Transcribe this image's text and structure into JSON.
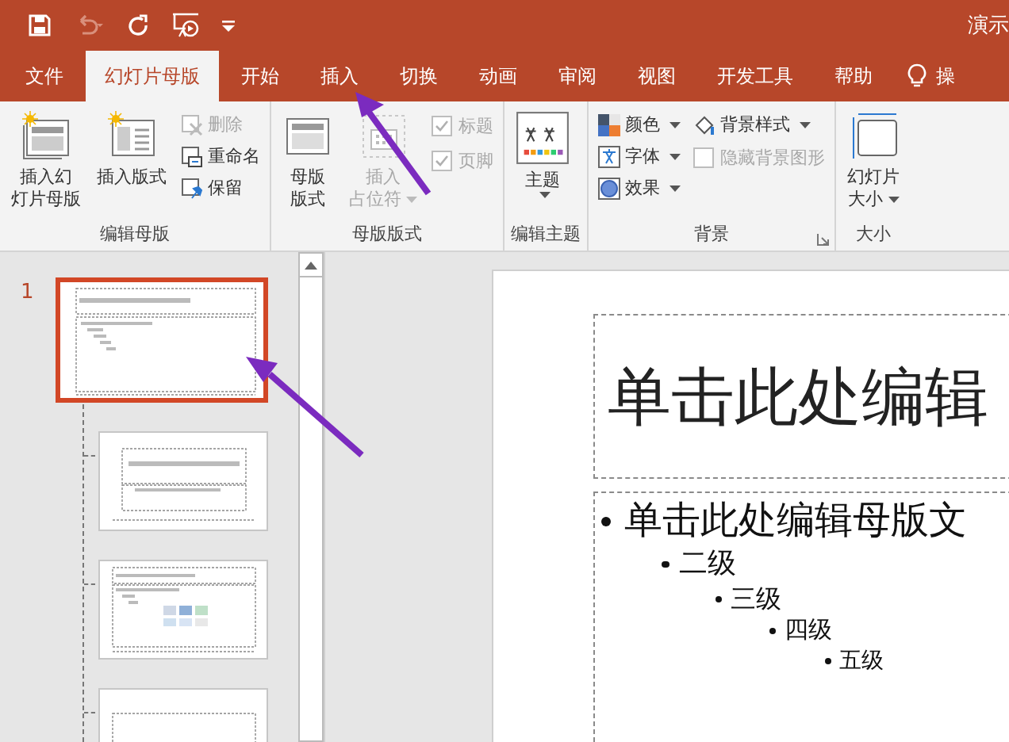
{
  "quick_access": [
    {
      "kind": "save",
      "disabled": false
    },
    {
      "kind": "undo",
      "disabled": true
    },
    {
      "kind": "redo",
      "disabled": false
    },
    {
      "kind": "slideshow",
      "disabled": false
    },
    {
      "kind": "customize",
      "disabled": false
    }
  ],
  "window": {
    "title": "演示"
  },
  "tabs": [
    {
      "label": "文件",
      "selected": false
    },
    {
      "label": "幻灯片母版",
      "selected": true
    },
    {
      "label": "开始",
      "selected": false
    },
    {
      "label": "插入",
      "selected": false
    },
    {
      "label": "切换",
      "selected": false
    },
    {
      "label": "动画",
      "selected": false
    },
    {
      "label": "审阅",
      "selected": false
    },
    {
      "label": "视图",
      "selected": false
    },
    {
      "label": "开发工具",
      "selected": false
    },
    {
      "label": "帮助",
      "selected": false
    }
  ],
  "tell_me": {
    "label": "操"
  },
  "ribbon": {
    "groups": [
      {
        "label": "编辑母版",
        "items": [
          {
            "kind": "large",
            "label": "插入幻灯片母版",
            "disabled": false
          },
          {
            "kind": "large",
            "label": "插入版式",
            "disabled": false
          },
          {
            "kind": "stack",
            "items": [
              {
                "kind": "small",
                "label": "删除",
                "disabled": true
              },
              {
                "kind": "small",
                "label": "重命名",
                "disabled": false
              },
              {
                "kind": "small",
                "label": "保留",
                "disabled": false
              }
            ]
          }
        ]
      },
      {
        "label": "母版版式",
        "items": [
          {
            "kind": "large",
            "label": "母版版式",
            "disabled": false
          },
          {
            "kind": "large",
            "label": "插入占位符",
            "disabled": true,
            "dropdown": true
          },
          {
            "kind": "stack",
            "items": [
              {
                "kind": "checkbox",
                "label": "标题",
                "checked": true,
                "disabled": true
              },
              {
                "kind": "checkbox",
                "label": "页脚",
                "checked": true,
                "disabled": true
              }
            ]
          }
        ]
      },
      {
        "label": "编辑主题",
        "items": [
          {
            "kind": "large",
            "label": "主题",
            "disabled": false,
            "dropdown": true
          }
        ]
      },
      {
        "label": "背景",
        "launcher": true,
        "items": [
          {
            "kind": "stack",
            "items": [
              {
                "kind": "small",
                "label": "颜色",
                "disabled": false,
                "dropdown": true
              },
              {
                "kind": "small",
                "label": "字体",
                "disabled": false,
                "dropdown": true
              },
              {
                "kind": "small",
                "label": "效果",
                "disabled": false,
                "dropdown": true
              }
            ]
          },
          {
            "kind": "stack",
            "items": [
              {
                "kind": "small",
                "label": "背景样式",
                "disabled": false,
                "dropdown": true
              },
              {
                "kind": "checkbox",
                "label": "隐藏背景图形",
                "checked": false,
                "disabled": true
              }
            ]
          }
        ]
      },
      {
        "label": "大小",
        "items": [
          {
            "kind": "large",
            "label": "幻灯片大小",
            "disabled": false,
            "dropdown": true
          }
        ]
      }
    ]
  },
  "thumbnails": [
    {
      "number": "1",
      "kind": "master",
      "selected": true
    },
    {
      "kind": "title",
      "selected": false
    },
    {
      "kind": "content",
      "selected": false
    },
    {
      "kind": "section",
      "selected": false
    }
  ],
  "slide": {
    "title": "单击此处编辑",
    "body": [
      {
        "text": "单击此处编辑母版文",
        "children": [
          {
            "text": "二级",
            "children": [
              {
                "text": "三级",
                "children": [
                  {
                    "text": "四级",
                    "children": [
                      {
                        "text": "五级"
                      }
                    ]
                  }
                ]
              }
            ]
          }
        ]
      }
    ]
  }
}
